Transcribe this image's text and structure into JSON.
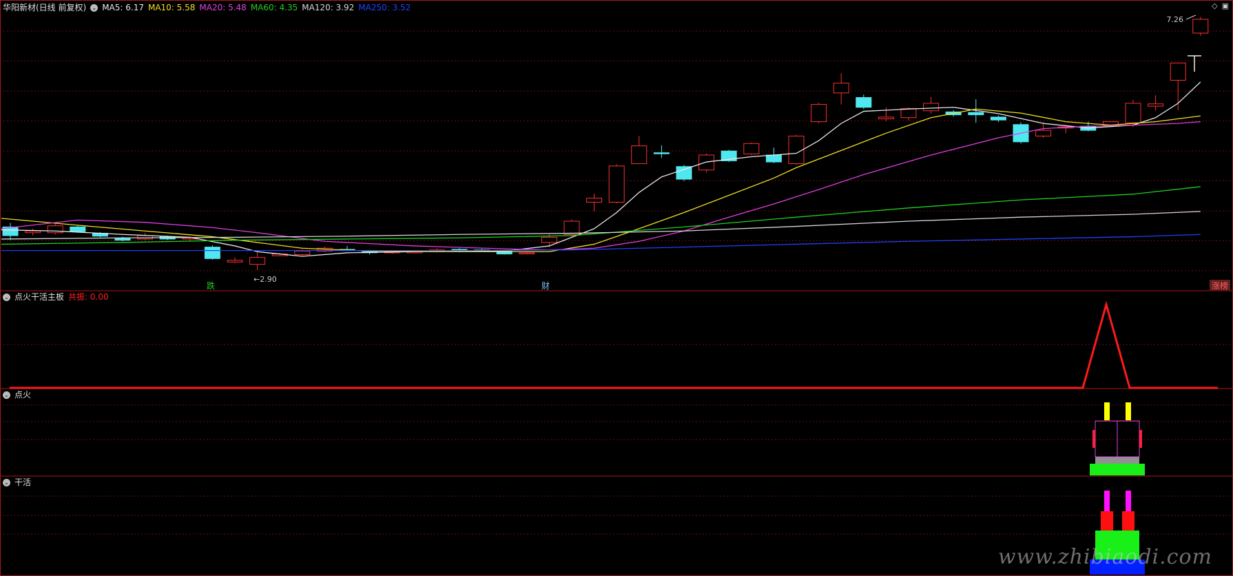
{
  "header": {
    "stock_name": "华阳新材(日线 前复权)",
    "ma": [
      {
        "label": "MA5: 6.17",
        "color": "#e8e8e8"
      },
      {
        "label": "MA10: 5.58",
        "color": "#f0e020"
      },
      {
        "label": "MA20: 5.48",
        "color": "#e040e0"
      },
      {
        "label": "MA60: 4.35",
        "color": "#20d020"
      },
      {
        "label": "MA120: 3.92",
        "color": "#d8d8d8"
      },
      {
        "label": "MA250: 3.52",
        "color": "#2040ff"
      }
    ],
    "corner_icons": [
      "◇",
      "▣"
    ]
  },
  "main_chart": {
    "high_label": "7.26",
    "low_label": "2.90",
    "markers": [
      {
        "text": "跌",
        "color": "#20d020"
      },
      {
        "text": "财",
        "color": "#80c0ff"
      },
      {
        "text": "涨榜",
        "color": "#ff6060",
        "bg": "#602020"
      }
    ]
  },
  "panel1": {
    "title": "点火干活主板",
    "value_label": "共振: 0.00",
    "value_color": "#ff2020"
  },
  "panel2": {
    "title": "点火"
  },
  "panel3": {
    "title": "干活"
  },
  "watermark": "www.zhibiaodi.com",
  "colors": {
    "up": "#ff3030",
    "down": "#50e8f0",
    "grid": "#6a1010",
    "border": "#b01818"
  }
}
